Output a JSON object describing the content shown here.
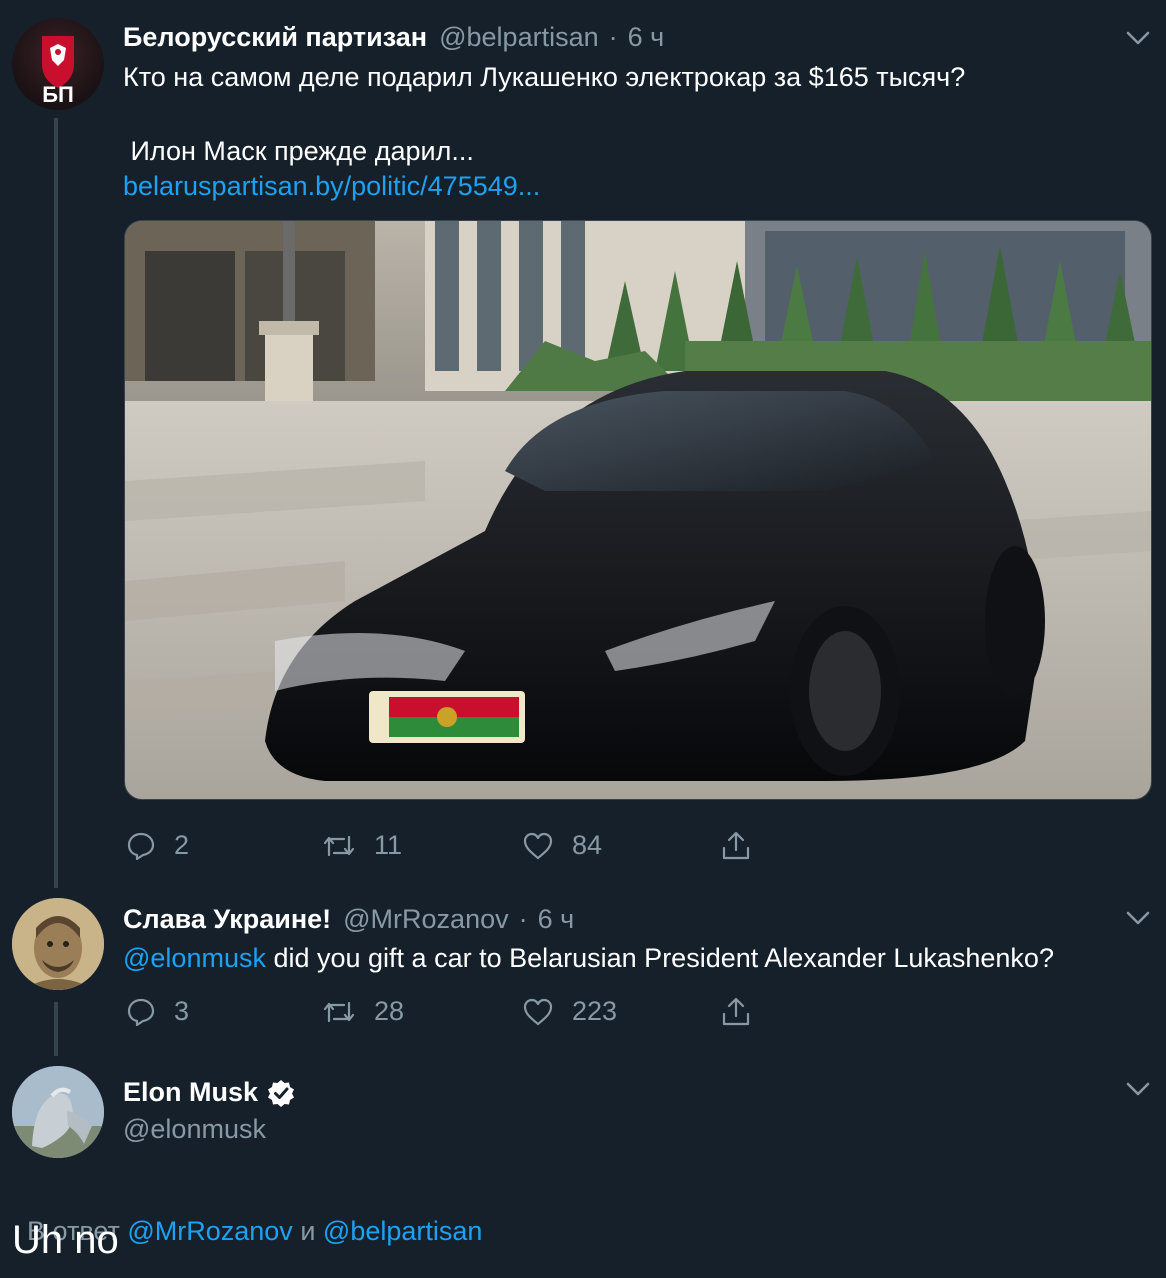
{
  "tweet1": {
    "avatar_text": "БП",
    "name": "Белорусский партизан",
    "handle": "@belpartisan",
    "separator": "·",
    "time": "6 ч",
    "line1": "Кто на самом деле подарил Лукашенко электрокар за $165 тысяч?",
    "line2": " Илон Маск прежде дарил...",
    "link": "belaruspartisan.by/politic/475549...",
    "replies": "2",
    "retweets": "11",
    "likes": "84"
  },
  "tweet2": {
    "name": "Слава Украине!",
    "handle": "@MrRozanov",
    "separator": "·",
    "time": "6 ч",
    "mention": "@elonmusk",
    "text": " did you gift a car to Belarusian President Alexander Lukashenko?",
    "replies": "3",
    "retweets": "28",
    "likes": "223"
  },
  "tweet3": {
    "name": "Elon Musk",
    "handle": "@elonmusk",
    "reply_prefix": "В ответ ",
    "reply_to_1": "@MrRozanov",
    "reply_and": " и ",
    "reply_to_2": "@belpartisan",
    "text": "Uh no"
  },
  "colors": {
    "background": "#15202b",
    "link": "#1da1f2",
    "muted": "#8899a6",
    "thread_line": "#38444d"
  },
  "icons": [
    "chevron-down-icon",
    "reply-icon",
    "retweet-icon",
    "like-icon",
    "share-icon",
    "verified-badge-icon"
  ]
}
